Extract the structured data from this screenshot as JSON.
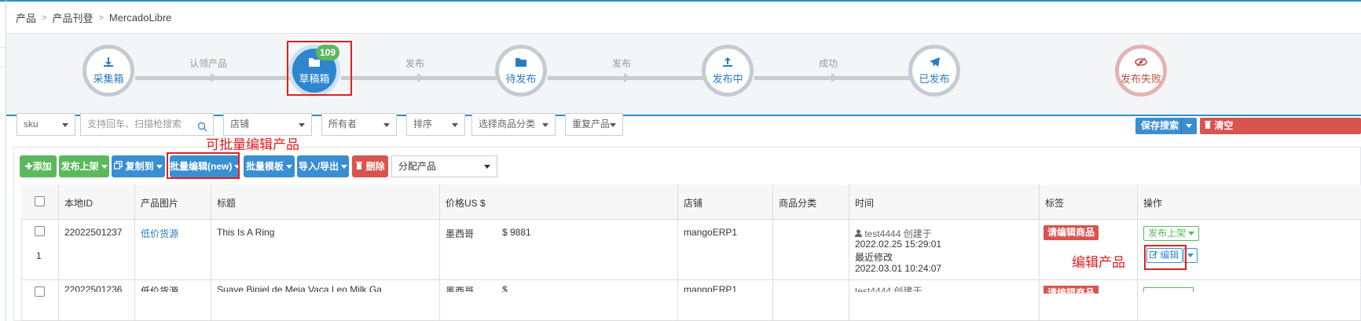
{
  "breadcrumb": [
    "产品",
    "产品刊登",
    "MercadoLibre"
  ],
  "workflow": {
    "steps": [
      {
        "label": "采集箱",
        "icon": "download-icon"
      },
      {
        "label": "草稿箱",
        "icon": "folder-icon",
        "badge": "109"
      },
      {
        "label": "待发布",
        "icon": "folder-icon"
      },
      {
        "label": "发布中",
        "icon": "upload-icon"
      },
      {
        "label": "已发布",
        "icon": "send-icon"
      },
      {
        "label": "发布失败",
        "icon": "eye-slash-icon"
      }
    ],
    "transitions": [
      "认领产品",
      "发布",
      "发布",
      "成功"
    ]
  },
  "filters": {
    "sku": "sku",
    "search_placeholder": "支持回车、扫描枪搜索",
    "store": "店铺",
    "owner": "所有者",
    "sort": "排序",
    "category": "选择商品分类",
    "duplicate": "重复产品",
    "save_search": "保存搜索",
    "clear": "清空"
  },
  "toolbar": {
    "add": "添加",
    "publish": "发布上架",
    "copy_to": "复制到",
    "batch_edit": "批量编辑(new)",
    "batch_template": "批量模板",
    "import_export": "导入/导出",
    "delete": "删除",
    "assign": "分配产品"
  },
  "annotations": {
    "batch_edit": "可批量编辑产品",
    "edit_product": "编辑产品"
  },
  "table": {
    "headers": [
      "本地ID",
      "产品图片",
      "标题",
      "价格US $",
      "店铺",
      "商品分类",
      "时间",
      "标签",
      "操作"
    ],
    "rows": [
      {
        "index": "1",
        "local_id": "22022501237",
        "image": "低价货源",
        "title": "This Is A Ring",
        "country": "墨西哥",
        "price": "$ 9881",
        "store": "mangoERP1",
        "category": "",
        "creator": "test4444 创建于",
        "created": "2022.02.25 15:29:01",
        "modified_label": "最近修改",
        "modified": "2022.03.01 10:24:07",
        "tag": "请编辑商品",
        "publish_btn": "发布上架",
        "edit_btn": "编辑"
      },
      {
        "local_id": "22022501236",
        "image": "低价货源",
        "title": "Suave Bipiel de Meia Vaca Leo Milk Ga",
        "country": "墨西哥",
        "price": "$",
        "store": "mangoERP1",
        "creator": "test4444 创建于",
        "tag": "请编辑商品"
      }
    ]
  }
}
